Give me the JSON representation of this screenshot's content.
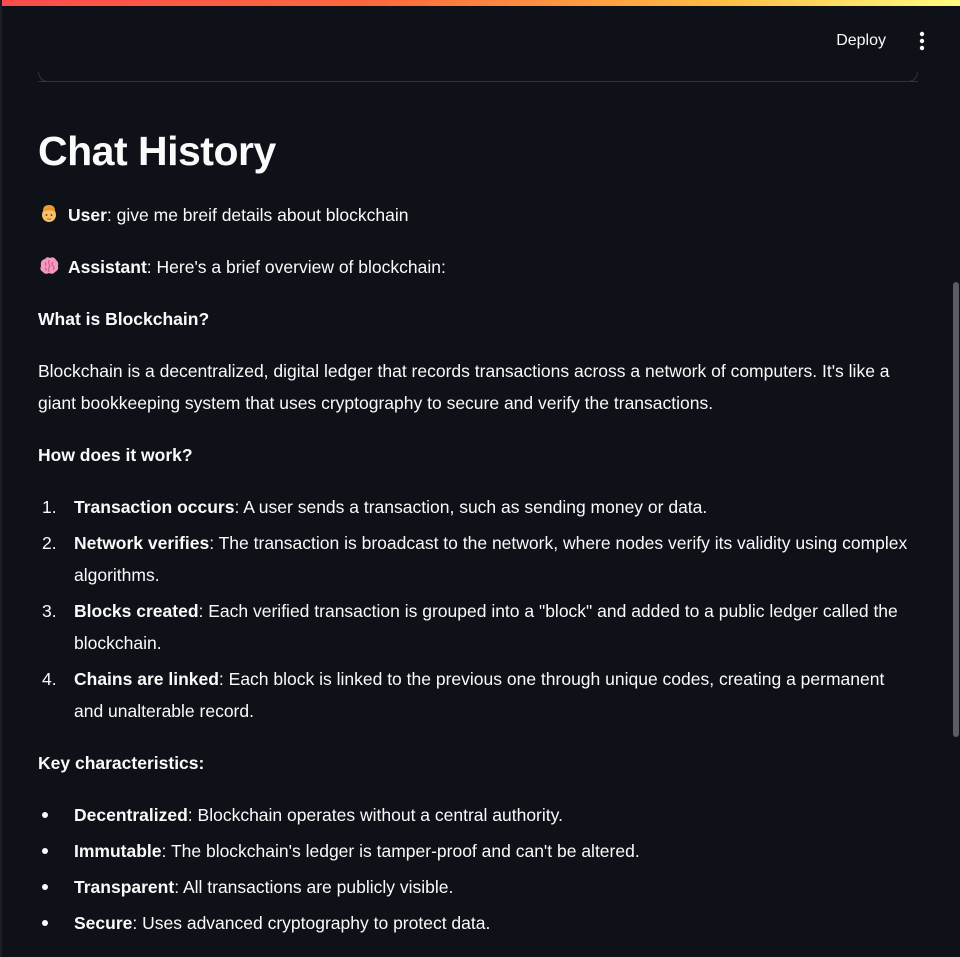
{
  "header": {
    "deploy_label": "Deploy",
    "menu_icon": "vertical-ellipsis-icon"
  },
  "page_title": "Chat History",
  "messages": [
    {
      "role_icon": "person-emoji",
      "role_label": "User",
      "separator": ": ",
      "text": "give me breif details about blockchain"
    },
    {
      "role_icon": "brain-emoji",
      "role_label": "Assistant",
      "separator": ": ",
      "text": "Here's a brief overview of blockchain:"
    }
  ],
  "answer": {
    "heading_what": "What is Blockchain?",
    "definition": "Blockchain is a decentralized, digital ledger that records transactions across a network of computers. It's like a giant bookkeeping system that uses cryptography to secure and verify the transactions.",
    "heading_how": "How does it work?",
    "steps": [
      {
        "num": "1.",
        "term": "Transaction occurs",
        "desc": ": A user sends a transaction, such as sending money or data."
      },
      {
        "num": "2.",
        "term": "Network verifies",
        "desc": ": The transaction is broadcast to the network, where nodes verify its validity using complex algorithms."
      },
      {
        "num": "3.",
        "term": "Blocks created",
        "desc": ": Each verified transaction is grouped into a \"block\" and added to a public ledger called the blockchain."
      },
      {
        "num": "4.",
        "term": "Chains are linked",
        "desc": ": Each block is linked to the previous one through unique codes, creating a permanent and unalterable record."
      }
    ],
    "heading_key": "Key characteristics:",
    "characteristics": [
      {
        "term": "Decentralized",
        "desc": ": Blockchain operates without a central authority."
      },
      {
        "term": "Immutable",
        "desc": ": The blockchain's ledger is tamper-proof and can't be altered."
      },
      {
        "term": "Transparent",
        "desc": ": All transactions are publicly visible."
      },
      {
        "term": "Secure",
        "desc": ": Uses advanced cryptography to protect data."
      }
    ]
  },
  "colors": {
    "background": "#0e1117",
    "text": "#fafafa",
    "accent_gradient_start": "#ff4b4b",
    "accent_gradient_end": "#fffd80"
  }
}
